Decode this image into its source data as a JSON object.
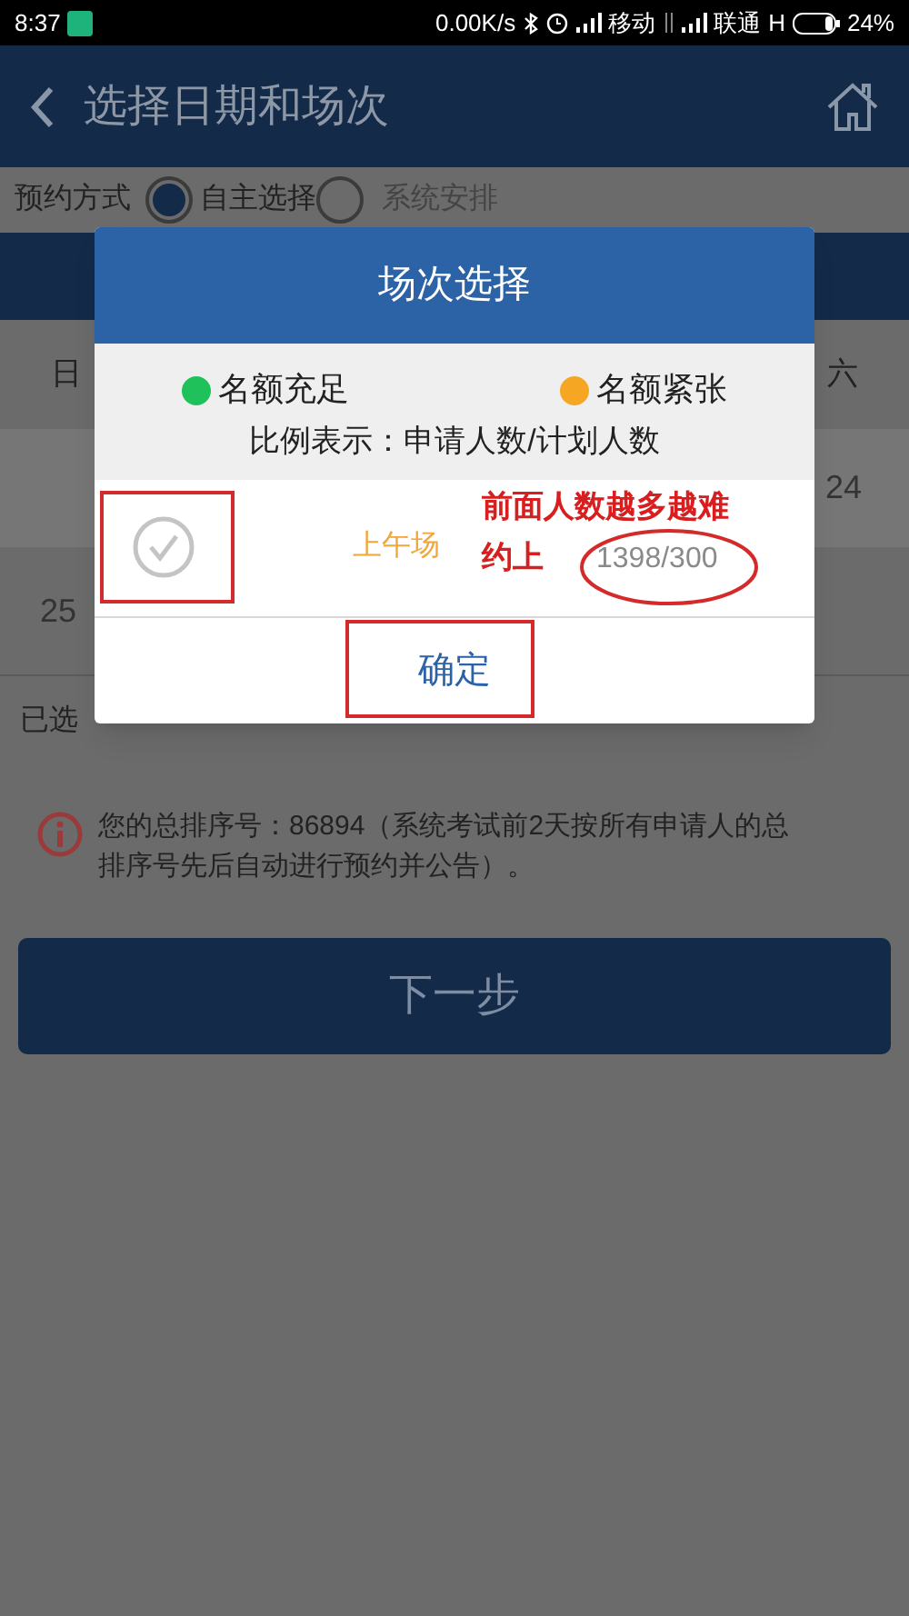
{
  "status_bar": {
    "time": "8:37",
    "network_speed": "0.00K/s",
    "carrier_1": "移动",
    "carrier_2": "联通",
    "network_type": "H",
    "battery": "24%"
  },
  "header": {
    "title": "选择日期和场次"
  },
  "booking_method": {
    "label": "预约方式",
    "options": [
      {
        "label": "自主选择",
        "selected": true
      },
      {
        "label": "系统安排",
        "selected": false
      }
    ]
  },
  "calendar": {
    "weekdays": [
      "日",
      "六"
    ],
    "dates": [
      "24",
      "25"
    ]
  },
  "selected_label": "已选",
  "notice": {
    "text": "您的总排序号：86894（系统考试前2天按所有申请人的总排序号先后自动进行预约并公告）。"
  },
  "next_button": "下一步",
  "dialog": {
    "title": "场次选择",
    "legend": [
      {
        "label": "名额充足",
        "color": "#1fc25a"
      },
      {
        "label": "名额紧张",
        "color": "#f5a623"
      }
    ],
    "ratio_note": "比例表示：申请人数/计划人数",
    "sessions": [
      {
        "checked": false,
        "name": "上午场",
        "ratio": "1398/300"
      }
    ],
    "confirm": "确定"
  },
  "annotations": [
    {
      "kind": "note",
      "text": "前面人数越多越难"
    },
    {
      "kind": "note",
      "text": "约上"
    }
  ]
}
